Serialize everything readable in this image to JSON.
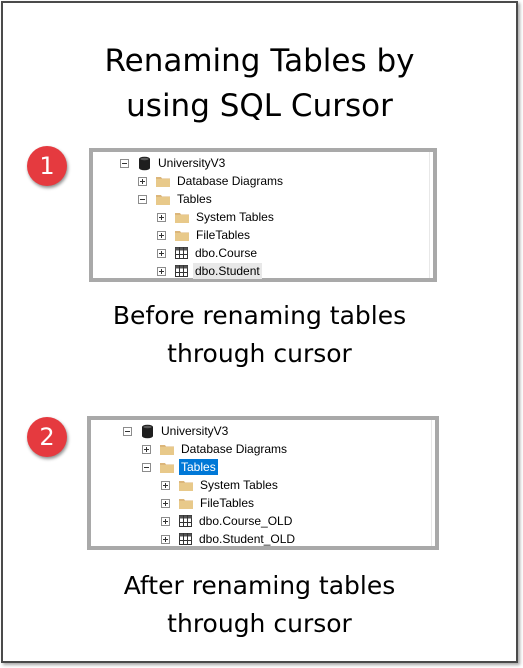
{
  "title_line1": "Renaming Tables by",
  "title_line2": "using SQL Cursor",
  "steps": [
    {
      "badge": "1",
      "tree": {
        "database": "UniversityV3",
        "database_diagrams": "Database Diagrams",
        "tables": "Tables",
        "system_tables": "System Tables",
        "file_tables": "FileTables",
        "table_1": "dbo.Course",
        "table_2": "dbo.Student"
      },
      "caption_line1": "Before renaming tables",
      "caption_line2": "through cursor"
    },
    {
      "badge": "2",
      "tree": {
        "database": "UniversityV3",
        "database_diagrams": "Database Diagrams",
        "tables": "Tables",
        "system_tables": "System Tables",
        "file_tables": "FileTables",
        "table_1": "dbo.Course_OLD",
        "table_2": "dbo.Student_OLD"
      },
      "caption_line1": "After renaming tables",
      "caption_line2": "through cursor"
    }
  ],
  "colors": {
    "badge": "#e53a3f",
    "panel_border": "#a9a9a9",
    "selection": "#0078d7",
    "folder": "#dcb67a"
  },
  "icons": [
    "database-icon",
    "folder-icon",
    "table-icon",
    "expand-icon",
    "collapse-icon"
  ]
}
